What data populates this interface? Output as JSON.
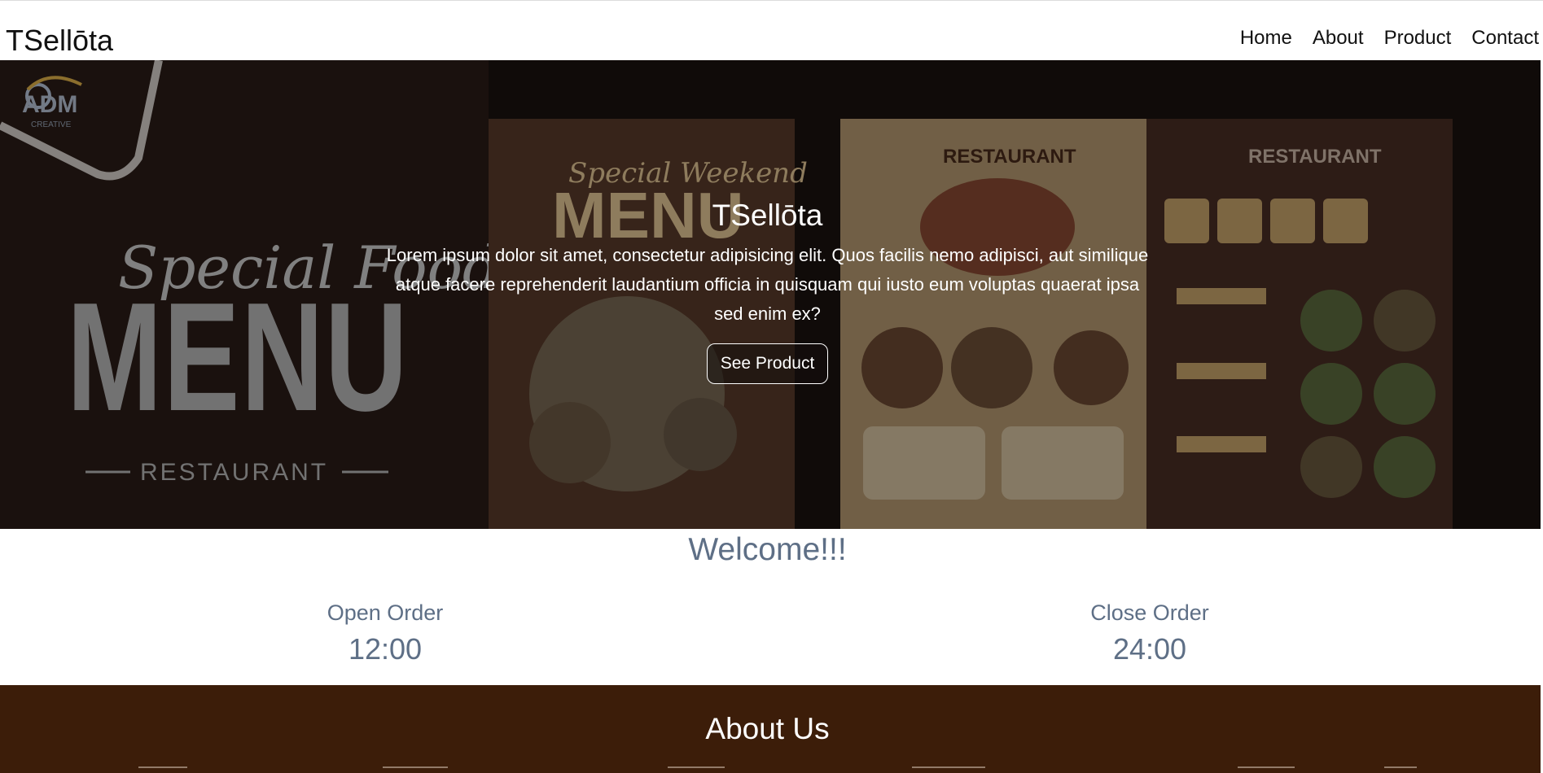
{
  "brand": "TSellōta",
  "nav": {
    "items": [
      "Home",
      "About",
      "Product",
      "Contact"
    ]
  },
  "hero": {
    "title": "TSellōta",
    "text": "Lorem ipsum dolor sit amet, consectetur adipisicing elit. Quos facilis nemo adipisci, aut similique atque facere reprehenderit laudantium officia in quisquam qui iusto eum voluptas quaerat ipsa sed enim ex?",
    "button": "See Product",
    "image": {
      "logo": "ADM",
      "logo_sub": "CREATIVE",
      "headline_script": "Special Food",
      "headline_big": "MENU",
      "headline_sub": "RESTAURANT",
      "card1_script": "Special Weekend",
      "card1_big": "MENU",
      "card2_title": "RESTAURANT",
      "card3_title": "RESTAURANT"
    }
  },
  "welcome": {
    "title": "Welcome!!!",
    "open_label": "Open Order",
    "open_time": "12:00",
    "close_label": "Close Order",
    "close_time": "24:00"
  },
  "about": {
    "title": "About Us"
  },
  "colors": {
    "hero_bg": "#1b1210",
    "welcome_text": "#5e6f86",
    "about_bg": "#3c1d09"
  }
}
